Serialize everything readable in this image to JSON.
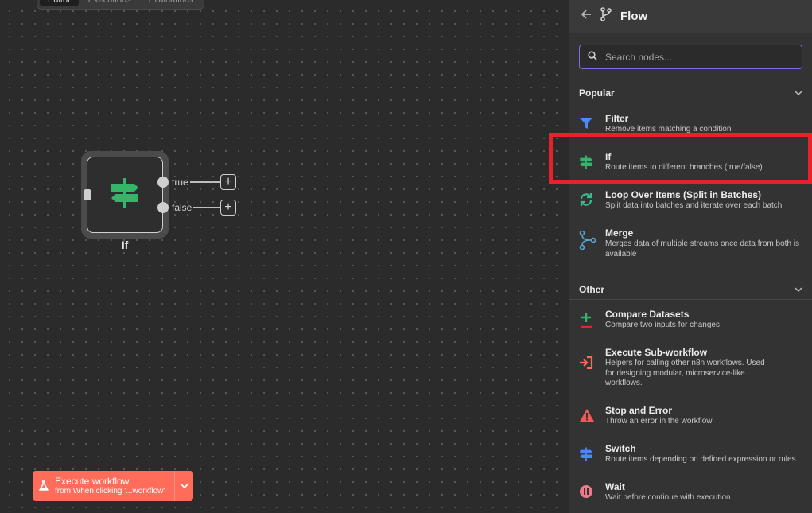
{
  "canvas": {
    "tabs": [
      {
        "label": "Editor",
        "active": true
      },
      {
        "label": "Executions",
        "active": false
      },
      {
        "label": "Evaluations",
        "active": false
      }
    ],
    "node": {
      "label": "If",
      "outputs": [
        {
          "label": "true"
        },
        {
          "label": "false"
        }
      ],
      "accent_color": "#35b56a"
    },
    "execute_button": {
      "title": "Execute workflow",
      "subtitle": "from When clicking '...workflow'",
      "color": "#ff6d5a"
    }
  },
  "panel": {
    "title": "Flow",
    "search": {
      "placeholder": "Search nodes...",
      "value": ""
    },
    "sections": [
      {
        "title": "Popular",
        "items": [
          {
            "title": "Filter",
            "desc": "Remove items matching a condition",
            "icon": "filter-icon",
            "color": "#4a8af4"
          },
          {
            "title": "If",
            "desc": "Route items to different branches (true/false)",
            "icon": "signpost-icon",
            "color": "#35b56a",
            "highlighted": true
          },
          {
            "title": "Loop Over Items (Split in Batches)",
            "desc": "Split data into batches and iterate over each batch",
            "icon": "loop-icon",
            "color": "#3cb993"
          },
          {
            "title": "Merge",
            "desc": "Merges data of multiple streams once data from both is available",
            "icon": "merge-icon",
            "color": "#5aa8cf"
          }
        ]
      },
      {
        "title": "Other",
        "items": [
          {
            "title": "Compare Datasets",
            "desc": "Compare two inputs for changes",
            "icon": "compare-icon",
            "color": "#35b56a"
          },
          {
            "title": "Execute Sub-workflow",
            "desc": "Helpers for calling other n8n workflows. Used for designing modular, microservice-like workflows.",
            "icon": "sign-in-icon",
            "color": "#ff6d5a"
          },
          {
            "title": "Stop and Error",
            "desc": "Throw an error in the workflow",
            "icon": "warning-icon",
            "color": "#f05a5a"
          },
          {
            "title": "Switch",
            "desc": "Route items depending on defined expression or rules",
            "icon": "switch-icon",
            "color": "#4a8af4"
          },
          {
            "title": "Wait",
            "desc": "Wait before continue with execution",
            "icon": "pause-icon",
            "color": "#f07a8a"
          }
        ]
      }
    ]
  }
}
